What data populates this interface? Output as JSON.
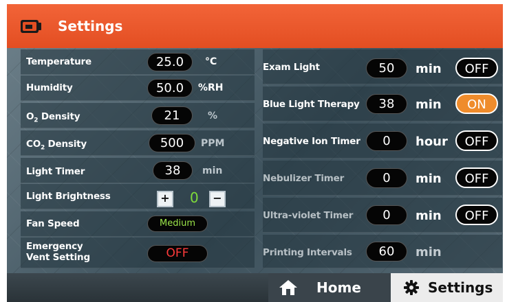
{
  "header": {
    "title": "Settings",
    "icon": "video-camera-icon"
  },
  "left_settings": {
    "temperature": {
      "label": "Temperature",
      "value": "25.0",
      "unit": "°C"
    },
    "humidity": {
      "label": "Humidity",
      "value": "50.0",
      "unit": "%RH"
    },
    "o2_density": {
      "label_main": "O",
      "label_sub": "2",
      "label_rest": " Density",
      "value": "21",
      "unit": "%"
    },
    "co2_density": {
      "label_main": "CO",
      "label_sub": "2",
      "label_rest": " Density",
      "value": "500",
      "unit": "PPM"
    },
    "light_timer": {
      "label": "Light Timer",
      "value": "38",
      "unit": "min"
    },
    "light_brightness": {
      "label": "Light Brightness",
      "plus": "+",
      "value": "0",
      "minus": "−"
    },
    "fan_speed": {
      "label": "Fan Speed",
      "value": "Medium"
    },
    "emergency_vent": {
      "label_line1": "Emergency",
      "label_line2": "Vent Setting",
      "value": "OFF"
    }
  },
  "right_settings": {
    "exam_light": {
      "label": "Exam Light",
      "value": "50",
      "unit": "min",
      "toggle": "OFF"
    },
    "blue_light": {
      "label": "Blue Light Therapy",
      "value": "38",
      "unit": "min",
      "toggle": "ON"
    },
    "negative_ion": {
      "label": "Negative Ion Timer",
      "value": "0",
      "unit": "hour",
      "toggle": "OFF"
    },
    "nebulizer": {
      "label": "Nebulizer Timer",
      "value": "0",
      "unit": "min",
      "toggle": "OFF"
    },
    "ultraviolet": {
      "label": "Ultra-violet Timer",
      "value": "0",
      "unit": "min",
      "toggle": "OFF"
    },
    "printing": {
      "label": "Printing Intervals",
      "value": "60",
      "unit": "min"
    }
  },
  "nav": {
    "home": {
      "label": "Home",
      "icon": "home-icon"
    },
    "settings": {
      "label": "Settings",
      "icon": "gear-icon"
    }
  },
  "colors": {
    "header": "#f05a2c",
    "toggle_on": "#ef8c2c",
    "fan_text": "#9be64a",
    "off_text": "#ff3b3b",
    "brightness_value": "#7fdc3a"
  }
}
